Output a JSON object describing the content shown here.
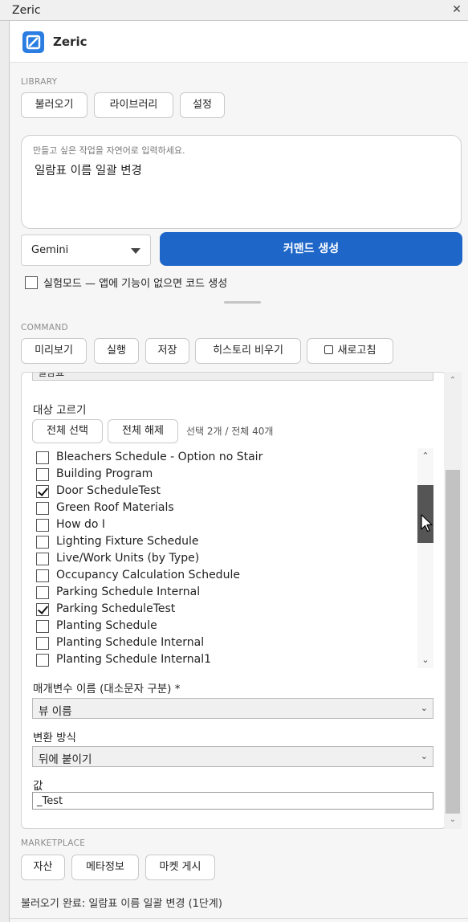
{
  "window": {
    "title": "Zeric",
    "close_glyph": "✕"
  },
  "header": {
    "brand": "Zeric",
    "logo_icon": "zeric-logo-icon",
    "accent": "#2b7de2"
  },
  "library": {
    "label": "LIBRARY",
    "buttons": [
      "불러오기",
      "라이브러리",
      "설정"
    ]
  },
  "prompt": {
    "placeholder": "만들고 싶은 작업을 자연어로 입력하세요.",
    "value": "일람표 이름 일괄 변경"
  },
  "model": {
    "selected": "Gemini"
  },
  "generate": {
    "label": "커맨드 생성",
    "color": "#1e67c9"
  },
  "experimental": {
    "label": "실험모드 — 앱에 기능이 없으면 코드 생성",
    "checked": false
  },
  "command": {
    "label": "COMMAND",
    "buttons": [
      "미리보기",
      "실행",
      "저장",
      "히스토리 비우기"
    ],
    "refresh_label": "새로고침",
    "refresh_icon": "refresh-icon"
  },
  "form": {
    "cut_select_value": "일람표",
    "target_label": "대상 고르기",
    "select_all": "전체 선택",
    "deselect_all": "전체 해제",
    "count_text": "선택 2개 / 전체 40개",
    "items": [
      {
        "label": "Bleachers Schedule - Option no Stair",
        "checked": false
      },
      {
        "label": "Building Program",
        "checked": false
      },
      {
        "label": "Door ScheduleTest",
        "checked": true
      },
      {
        "label": "Green Roof Materials",
        "checked": false
      },
      {
        "label": "How do I",
        "checked": false
      },
      {
        "label": "Lighting Fixture Schedule",
        "checked": false
      },
      {
        "label": "Live/Work Units (by Type)",
        "checked": false
      },
      {
        "label": "Occupancy Calculation Schedule",
        "checked": false
      },
      {
        "label": "Parking Schedule Internal",
        "checked": false
      },
      {
        "label": "Parking ScheduleTest",
        "checked": true
      },
      {
        "label": "Planting Schedule",
        "checked": false
      },
      {
        "label": "Planting Schedule Internal",
        "checked": false
      },
      {
        "label": "Planting Schedule Internal1",
        "checked": false
      }
    ],
    "param_label": "매개변수 이름 (대소문자 구분) *",
    "param_value": "뷰 이름",
    "mode_label": "변환 방식",
    "mode_value": "뒤에 붙이기",
    "value_label": "값",
    "value_value": "_Test",
    "scroll_up_glyph": "⌃",
    "scroll_down_glyph": "⌄",
    "dropdown_glyph": "⌄"
  },
  "marketplace": {
    "label": "MARKETPLACE",
    "buttons": [
      "자산",
      "메타정보",
      "마켓 게시"
    ]
  },
  "status": {
    "text": "불러오기 완료: 일람표 이름 일괄 변경 (1단계)"
  }
}
